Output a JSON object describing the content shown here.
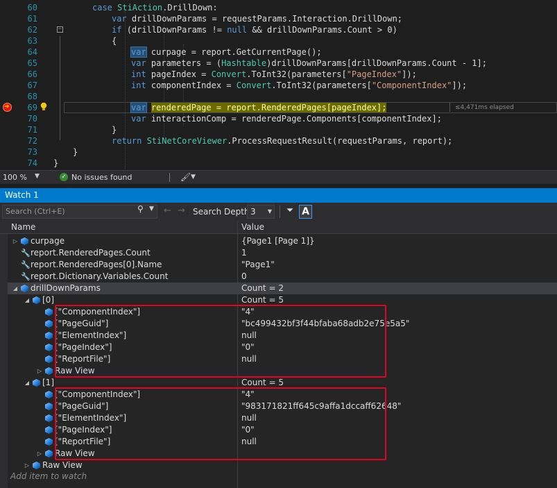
{
  "editor": {
    "lines": [
      {
        "num": "60",
        "tokens": [
          [
            "kw",
            "case "
          ],
          [
            "ty",
            "StiAction"
          ],
          [
            "tx",
            ".DrillDown:"
          ]
        ],
        "indent": 133
      },
      {
        "num": "61",
        "tokens": [
          [
            "kw",
            "var "
          ],
          [
            "tx",
            "drillDownParams = requestParams.Interaction.DrillDown;"
          ]
        ],
        "indent": 161
      },
      {
        "num": "62",
        "tokens": [
          [
            "kw",
            "if "
          ],
          [
            "tx",
            "(drillDownParams != "
          ],
          [
            "kw",
            "null"
          ],
          [
            "tx",
            " && drillDownParams.Count > 0)"
          ]
        ],
        "indent": 161
      },
      {
        "num": "63",
        "tokens": [
          [
            "tx",
            "{"
          ]
        ],
        "indent": 161
      },
      {
        "num": "64",
        "tokens": [
          [
            "kwhl",
            "var"
          ],
          [
            "tx",
            " curpage = report.GetCurrentPage();"
          ]
        ],
        "indent": 189
      },
      {
        "num": "65",
        "tokens": [
          [
            "kw",
            "var "
          ],
          [
            "tx",
            "parameters = ("
          ],
          [
            "ty",
            "Hashtable"
          ],
          [
            "tx",
            ")drillDownParams[drillDownParams.Count - 1];"
          ]
        ],
        "indent": 189
      },
      {
        "num": "66",
        "tokens": [
          [
            "kw",
            "int "
          ],
          [
            "tx",
            "pageIndex = "
          ],
          [
            "ty",
            "Convert"
          ],
          [
            "tx",
            ".ToInt32(parameters["
          ],
          [
            "st",
            "\"PageIndex\""
          ],
          [
            "tx",
            "]);"
          ]
        ],
        "indent": 189
      },
      {
        "num": "67",
        "tokens": [
          [
            "kw",
            "int "
          ],
          [
            "tx",
            "componentIndex = "
          ],
          [
            "ty",
            "Convert"
          ],
          [
            "tx",
            ".ToInt32(parameters["
          ],
          [
            "st",
            "\"ComponentIndex\""
          ],
          [
            "tx",
            "]);"
          ]
        ],
        "indent": 189
      },
      {
        "num": "68",
        "tokens": [],
        "indent": 189
      },
      {
        "num": "69",
        "tokens": [
          [
            "kwhl",
            "var"
          ],
          [
            "tx",
            " "
          ],
          [
            "selhl",
            "renderedPage = report.RenderedPages[pageIndex];"
          ]
        ],
        "indent": 189
      },
      {
        "num": "70",
        "tokens": [
          [
            "kw",
            "var "
          ],
          [
            "tx",
            "interactionComp = renderedPage.Components[componentIndex];"
          ]
        ],
        "indent": 189
      },
      {
        "num": "71",
        "tokens": [
          [
            "tx",
            "}"
          ]
        ],
        "indent": 161
      },
      {
        "num": "72",
        "tokens": [
          [
            "kw",
            "return "
          ],
          [
            "ty",
            "StiNetCoreViewer"
          ],
          [
            "tx",
            ".ProcessRequestResult(requestParams, report);"
          ]
        ],
        "indent": 161
      },
      {
        "num": "73",
        "tokens": [
          [
            "tx",
            "}"
          ]
        ],
        "indent": 105
      },
      {
        "num": "74",
        "tokens": [
          [
            "tx",
            "}"
          ]
        ],
        "indent": 77
      }
    ],
    "elapsed": "≤4,471ms elapsed"
  },
  "status": {
    "zoom": "100 %",
    "issues": "No issues found"
  },
  "watch": {
    "title": "Watch 1",
    "search_placeholder": "Search (Ctrl+E)",
    "depth_label": "Search Depth:",
    "depth_value": "3",
    "col_name": "Name",
    "col_value": "Value",
    "add_item": "Add item to watch",
    "rows": [
      {
        "name": "curpage",
        "value": "{Page1 [Page 1]}",
        "level": 0,
        "exp": "right",
        "icon": "cube"
      },
      {
        "name": "report.RenderedPages.Count",
        "value": "1",
        "level": 0,
        "exp": "",
        "icon": "wrench"
      },
      {
        "name": "report.RenderedPages[0].Name",
        "value": "\"Page1\"",
        "level": 0,
        "exp": "",
        "icon": "wrench"
      },
      {
        "name": "report.Dictionary.Variables.Count",
        "value": "0",
        "level": 0,
        "exp": "",
        "icon": "wrench"
      },
      {
        "name": "drillDownParams",
        "value": "Count = 2",
        "level": 0,
        "exp": "down",
        "icon": "cube",
        "sel": true
      },
      {
        "name": "[0]",
        "value": "Count = 5",
        "level": 1,
        "exp": "down",
        "icon": "cube"
      },
      {
        "name": "[\"ComponentIndex\"]",
        "value": "\"4\"",
        "level": 2,
        "exp": "",
        "icon": "cube"
      },
      {
        "name": "[\"PageGuid\"]",
        "value": "\"bc499432bf3f44bfaba68adb2e75e5a5\"",
        "level": 2,
        "exp": "",
        "icon": "cube"
      },
      {
        "name": "[\"ElementIndex\"]",
        "value": "null",
        "level": 2,
        "exp": "",
        "icon": "cube"
      },
      {
        "name": "[\"PageIndex\"]",
        "value": "\"0\"",
        "level": 2,
        "exp": "",
        "icon": "cube"
      },
      {
        "name": "[\"ReportFile\"]",
        "value": "null",
        "level": 2,
        "exp": "",
        "icon": "cube"
      },
      {
        "name": "Raw View",
        "value": "",
        "level": 2,
        "exp": "right",
        "icon": "cube",
        "raw": true
      },
      {
        "name": "[1]",
        "value": "Count = 5",
        "level": 1,
        "exp": "down",
        "icon": "cube"
      },
      {
        "name": "[\"ComponentIndex\"]",
        "value": "\"4\"",
        "level": 2,
        "exp": "",
        "icon": "cube"
      },
      {
        "name": "[\"PageGuid\"]",
        "value": "\"983171821ff645c9affa1dccaff62648\"",
        "level": 2,
        "exp": "",
        "icon": "cube"
      },
      {
        "name": "[\"ElementIndex\"]",
        "value": "null",
        "level": 2,
        "exp": "",
        "icon": "cube"
      },
      {
        "name": "[\"PageIndex\"]",
        "value": "\"0\"",
        "level": 2,
        "exp": "",
        "icon": "cube"
      },
      {
        "name": "[\"ReportFile\"]",
        "value": "null",
        "level": 2,
        "exp": "",
        "icon": "cube"
      },
      {
        "name": "Raw View",
        "value": "",
        "level": 2,
        "exp": "right",
        "icon": "cube",
        "raw": true
      },
      {
        "name": "Raw View",
        "value": "",
        "level": 1,
        "exp": "right",
        "icon": "cube",
        "raw": true
      }
    ]
  },
  "colors": {
    "accent": "#007acc",
    "highlight_box": "#c8102e",
    "breakpoint": "#e51400"
  }
}
